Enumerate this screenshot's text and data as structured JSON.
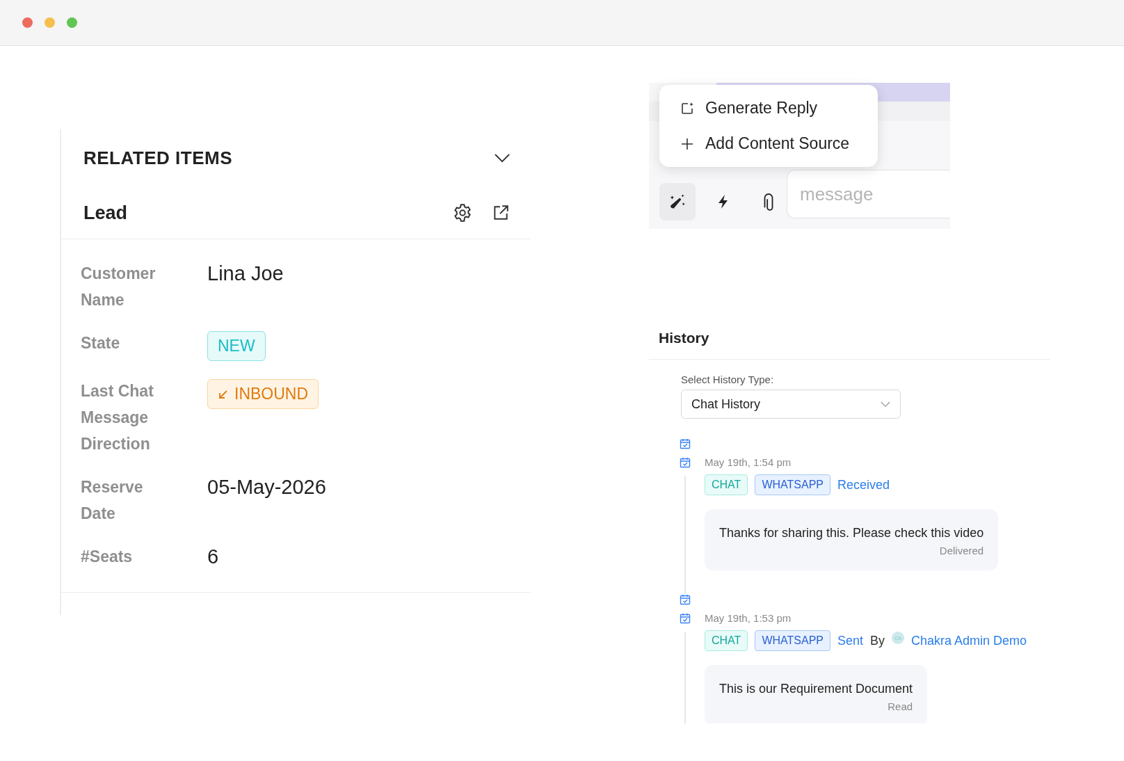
{
  "window": {
    "controls": [
      {
        "color": "#ed6a5e"
      },
      {
        "color": "#f5bf4f"
      },
      {
        "color": "#61c554"
      }
    ]
  },
  "related_items": {
    "title": "RELATED ITEMS",
    "record": {
      "title": "Lead",
      "fields": [
        {
          "label": "Customer Name",
          "kind": "text",
          "value": "Lina Joe"
        },
        {
          "label": "State",
          "kind": "state-badge",
          "value": "NEW"
        },
        {
          "label": "Last Chat Message Direction",
          "kind": "direction-badge",
          "value": "INBOUND"
        },
        {
          "label": "Reserve Date",
          "kind": "text",
          "value": "05-May-2026"
        },
        {
          "label": "#Seats",
          "kind": "text",
          "value": "6"
        }
      ]
    }
  },
  "composer": {
    "menu": [
      {
        "label": "Generate Reply",
        "kind": "generate"
      },
      {
        "label": "Add Content Source",
        "kind": "add"
      }
    ],
    "tools": [
      {
        "kind": "magic",
        "selected": true
      },
      {
        "kind": "bolt",
        "selected": false
      },
      {
        "kind": "attach",
        "selected": false
      }
    ],
    "placeholder": "message"
  },
  "history": {
    "title": "History",
    "select": {
      "label": "Select History Type:",
      "value": "Chat History"
    },
    "entries": [
      {
        "time": "May 19th, 1:54 pm",
        "tags": [
          {
            "label": "CHAT",
            "kind": "channel"
          },
          {
            "label": "WHATSAPP",
            "kind": "source"
          }
        ],
        "direction": "Received",
        "message": "Thanks for sharing this. Please check this video",
        "status": "Delivered"
      },
      {
        "time": "May 19th, 1:53 pm",
        "tags": [
          {
            "label": "CHAT",
            "kind": "channel"
          },
          {
            "label": "WHATSAPP",
            "kind": "source"
          }
        ],
        "direction": "Sent",
        "by": "By",
        "sender": {
          "initials": "CA",
          "name": "Chakra Admin Demo"
        },
        "message": "This is our Requirement Document",
        "status": "Read"
      }
    ]
  }
}
